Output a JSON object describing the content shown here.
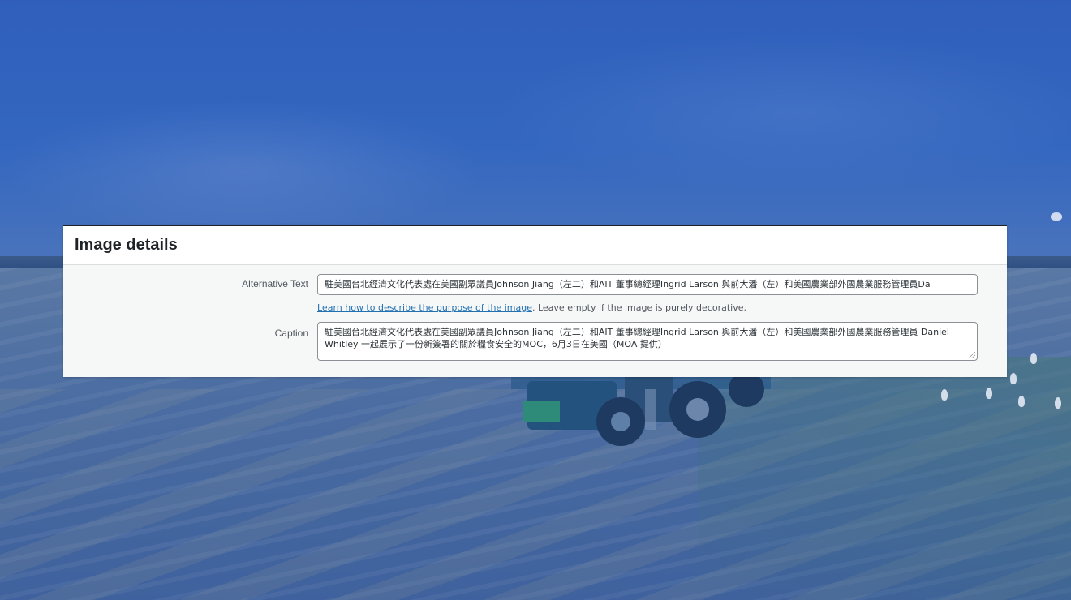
{
  "panel": {
    "title": "Image details"
  },
  "fields": {
    "alt_label": "Alternative Text",
    "alt_value": "駐美國台北經濟文化代表處在美國副眾議員Johnson Jiang（左二）和AIT 董事總經理Ingrid Larson 與前大潘（左）和美國農業部外國農業服務管理員Da",
    "help_link": "Learn how to describe the purpose of the image",
    "help_text": ". Leave empty if the image is purely decorative.",
    "caption_label": "Caption",
    "caption_value": "駐美國台北經濟文化代表處在美國副眾議員Johnson Jiang（左二）和AIT 董事總經理Ingrid Larson 與前大潘（左）和美國農業部外國農業服務管理員 Daniel Whitley 一起展示了一份新簽署的關於糧食安全的MOC，6月3日在美國（MOA 提供）"
  },
  "colors": {
    "link": "#2271b1",
    "overlay": "#3563ad"
  }
}
